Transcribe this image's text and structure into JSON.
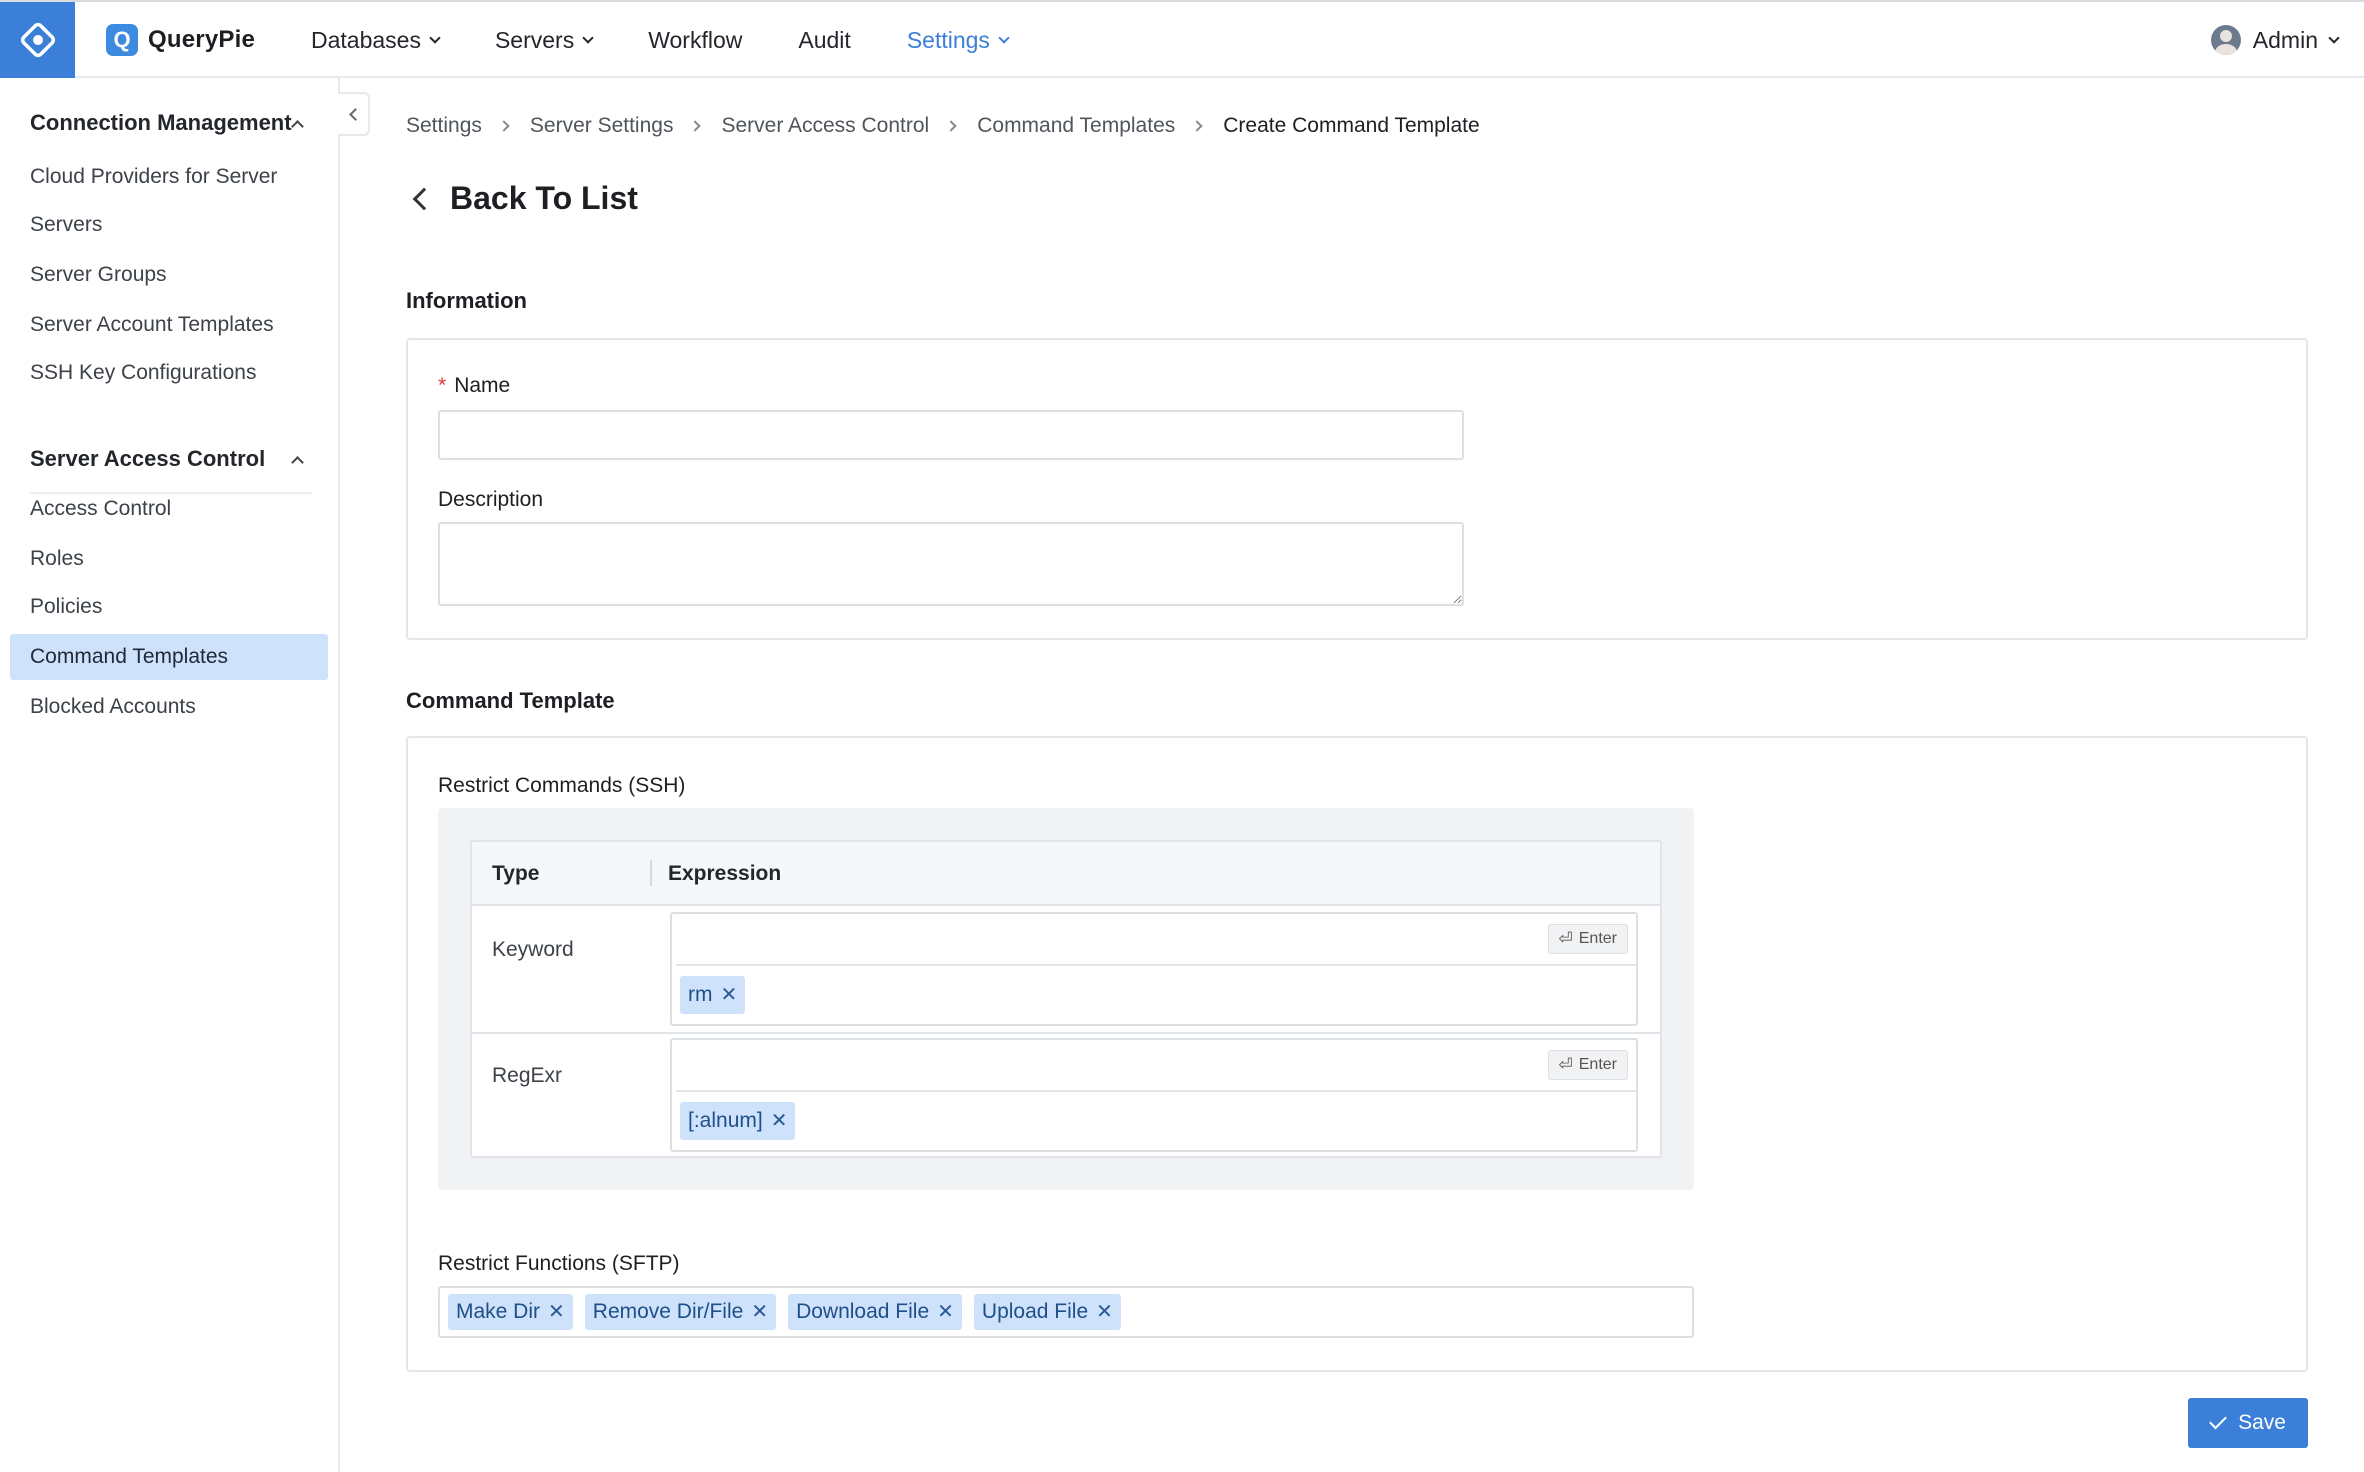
{
  "app": {
    "name": "QueryPie",
    "logo_letter": "Q",
    "brand_color": "#3b7fd9"
  },
  "nav": {
    "items": [
      {
        "label": "Databases",
        "has_dropdown": true,
        "active": false
      },
      {
        "label": "Servers",
        "has_dropdown": true,
        "active": false
      },
      {
        "label": "Workflow",
        "has_dropdown": false,
        "active": false
      },
      {
        "label": "Audit",
        "has_dropdown": false,
        "active": false
      },
      {
        "label": "Settings",
        "has_dropdown": true,
        "active": true
      }
    ],
    "user": "Admin"
  },
  "sidebar": {
    "groups": [
      {
        "title": "Connection Management",
        "items": [
          "Cloud Providers for Server",
          "Servers",
          "Server Groups",
          "Server Account Templates",
          "SSH Key Configurations"
        ]
      },
      {
        "title": "Server Access Control",
        "items": [
          "Access Control",
          "Roles",
          "Policies",
          "Command Templates",
          "Blocked Accounts"
        ]
      }
    ],
    "active_item": "Command Templates"
  },
  "breadcrumb": [
    "Settings",
    "Server Settings",
    "Server Access Control",
    "Command Templates",
    "Create Command Template"
  ],
  "back_label": "Back To List",
  "information": {
    "title": "Information",
    "name_label": "Name",
    "name_value": "",
    "description_label": "Description",
    "description_value": ""
  },
  "command_template": {
    "title": "Command Template",
    "ssh_label": "Restrict Commands (SSH)",
    "table_headers": {
      "type": "Type",
      "expression": "Expression"
    },
    "rows": [
      {
        "type": "Keyword",
        "input_value": "",
        "enter_label": "Enter",
        "tags": [
          "rm"
        ]
      },
      {
        "type": "RegExr",
        "input_value": "",
        "enter_label": "Enter",
        "tags": [
          "[:alnum]"
        ]
      }
    ],
    "sftp_label": "Restrict Functions (SFTP)",
    "sftp_tags": [
      "Make Dir",
      "Remove Dir/File",
      "Download File",
      "Upload File"
    ]
  },
  "save_label": "Save"
}
